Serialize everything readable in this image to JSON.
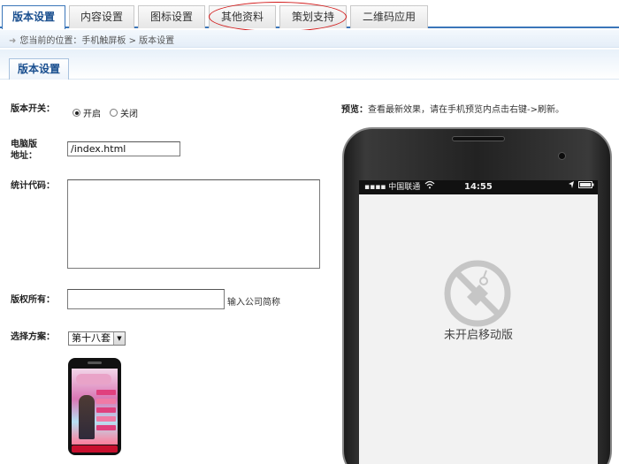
{
  "tabs": [
    {
      "label": "版本设置",
      "active": true
    },
    {
      "label": "内容设置",
      "active": false
    },
    {
      "label": "图标设置",
      "active": false
    },
    {
      "label": "其他资料",
      "active": false
    },
    {
      "label": "策划支持",
      "active": false
    },
    {
      "label": "二维码应用",
      "active": false
    }
  ],
  "breadcrumb": {
    "prefix": "您当前的位置：",
    "path": "手机触屏板 > 版本设置"
  },
  "section": {
    "title": "版本设置"
  },
  "form": {
    "switch": {
      "label": "版本开关：",
      "on_label": "开启",
      "off_label": "关闭",
      "selected": "开启"
    },
    "pc_url": {
      "label_line1": "电脑版",
      "label_line2": "地址：",
      "value": "/index.html"
    },
    "stats_code": {
      "label": "统计代码：",
      "value": ""
    },
    "copyright": {
      "label": "版权所有：",
      "value": "",
      "hint": "输入公司简称"
    },
    "scheme": {
      "label": "选择方案：",
      "selected": "第十八套"
    }
  },
  "preview": {
    "label": "预览：",
    "hint": "查看最新效果，请在手机预览内点击右键->刷新。",
    "carrier": "中国联通",
    "time": "14:55",
    "empty_text": "未开启移动版"
  },
  "colors": {
    "accent": "#3b76b9",
    "annotation": "#d21a1a"
  },
  "icons": [
    "radio-icon",
    "wifi-icon",
    "location-icon",
    "battery-icon",
    "disabled-icon",
    "dropdown-arrow-icon"
  ]
}
